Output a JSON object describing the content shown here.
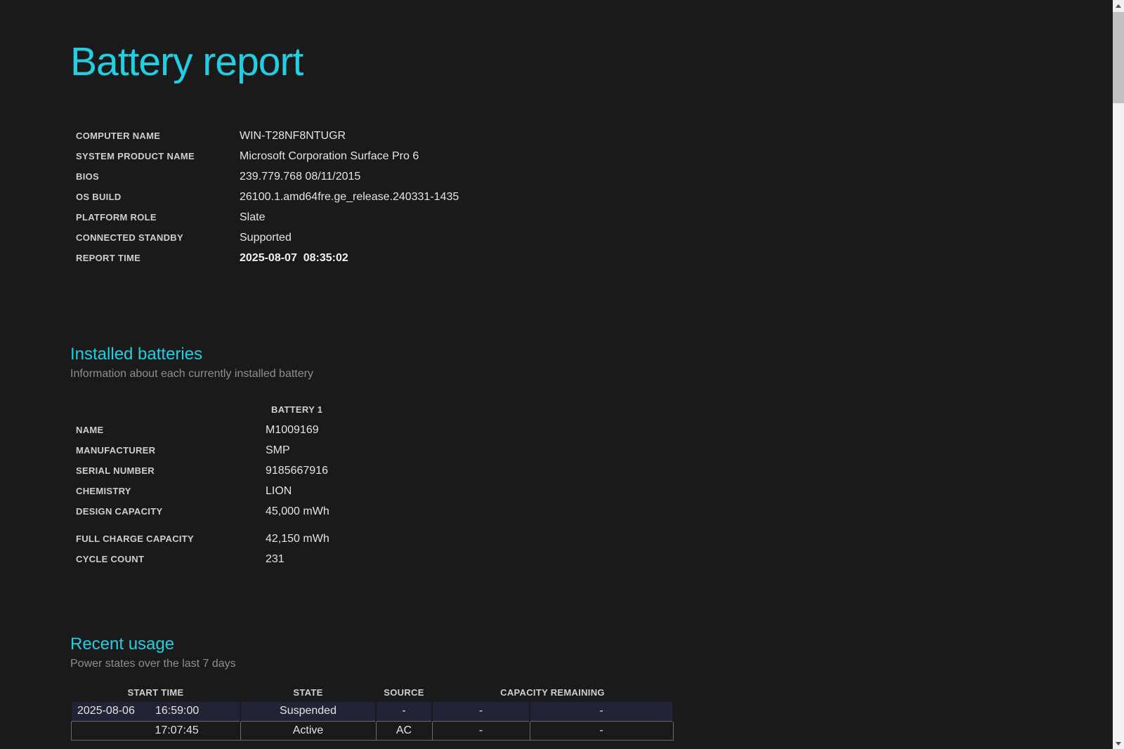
{
  "page": {
    "title": "Battery report"
  },
  "system_info": {
    "rows": [
      {
        "label": "COMPUTER NAME",
        "value": "WIN-T28NF8NTUGR"
      },
      {
        "label": "SYSTEM PRODUCT NAME",
        "value": "Microsoft Corporation Surface Pro 6"
      },
      {
        "label": "BIOS",
        "value": "239.779.768 08/11/2015"
      },
      {
        "label": "OS BUILD",
        "value": "26100.1.amd64fre.ge_release.240331-1435"
      },
      {
        "label": "PLATFORM ROLE",
        "value": "Slate"
      },
      {
        "label": "CONNECTED STANDBY",
        "value": "Supported"
      },
      {
        "label": "REPORT TIME",
        "value": "2025-08-07  08:35:02"
      }
    ]
  },
  "installed_batteries": {
    "heading": "Installed batteries",
    "subtitle": "Information about each currently installed battery",
    "column_header": "BATTERY 1",
    "rows": [
      {
        "label": "NAME",
        "value": "M1009169"
      },
      {
        "label": "MANUFACTURER",
        "value": "SMP"
      },
      {
        "label": "SERIAL NUMBER",
        "value": "9185667916"
      },
      {
        "label": "CHEMISTRY",
        "value": "LION"
      },
      {
        "label": "DESIGN CAPACITY",
        "value": "45,000 mWh"
      },
      {
        "label": "FULL CHARGE CAPACITY",
        "value": "42,150 mWh"
      },
      {
        "label": "CYCLE COUNT",
        "value": "231"
      }
    ]
  },
  "recent_usage": {
    "heading": "Recent usage",
    "subtitle": "Power states over the last 7 days",
    "columns": [
      "START TIME",
      "STATE",
      "SOURCE",
      "CAPACITY REMAINING"
    ],
    "rows": [
      {
        "date": "2025-08-06",
        "time": "16:59:00",
        "state": "Suspended",
        "source": "-",
        "capacity_percent": "-",
        "capacity_mwh": "-",
        "highlighted": true
      },
      {
        "date": "",
        "time": "17:07:45",
        "state": "Active",
        "source": "AC",
        "capacity_percent": "-",
        "capacity_mwh": "-",
        "highlighted": false
      }
    ]
  },
  "colors": {
    "bg": "#1a1a1a",
    "accent": "#22cfe2",
    "label": "#cfcfcf",
    "value": "#e4e4e4",
    "muted": "#8e8e8e",
    "suspended-row-bg": "#232337",
    "table-border": "#6b6b6b",
    "scroll-track": "#f1f1f1",
    "scroll-thumb": "#c1c1c1",
    "scroll-arrow": "#505050"
  }
}
